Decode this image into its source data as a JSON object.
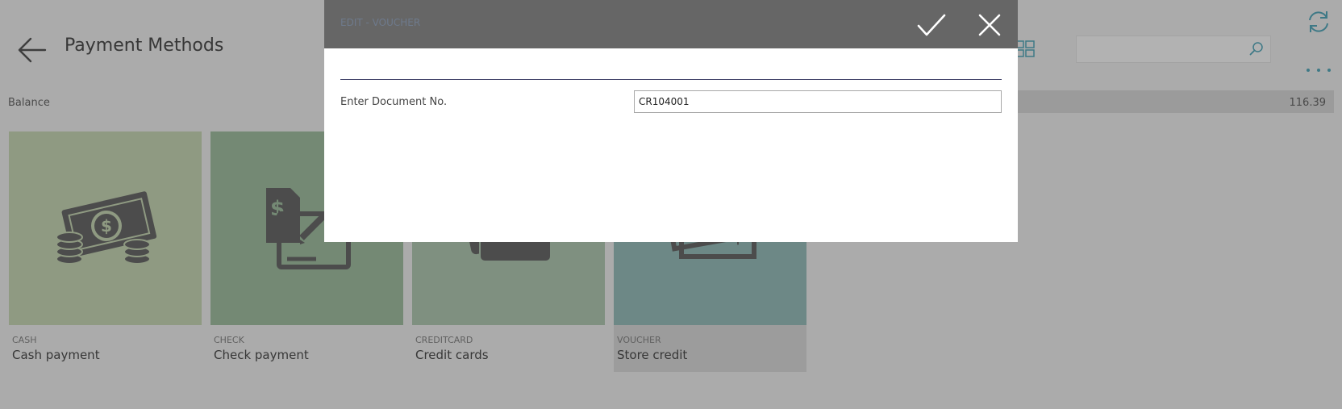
{
  "header": {
    "title": "Payment Methods",
    "back_icon": "arrow-left-icon",
    "search": {
      "value": "",
      "placeholder": ""
    },
    "icons": [
      "grid-view-icon",
      "search-icon",
      "refresh-icon",
      "more-icon"
    ]
  },
  "balance": {
    "label": "Balance",
    "value": "116.39"
  },
  "tiles": [
    {
      "code": "CASH",
      "name": "Cash payment",
      "icon": "cash-icon",
      "color": "#cdddba"
    },
    {
      "code": "CHECK",
      "name": "Check payment",
      "icon": "check-icon",
      "color": "#a6c4a6"
    },
    {
      "code": "CREDITCARD",
      "name": "Credit cards",
      "icon": "credit-card-icon",
      "color": "#b7ceb8"
    },
    {
      "code": "VOUCHER",
      "name": "Store credit",
      "icon": "voucher-icon",
      "color": "#9dc3c0"
    }
  ],
  "dialog": {
    "title": "EDIT - VOUCHER",
    "ok_icon": "checkmark-icon",
    "close_icon": "close-icon",
    "field_label": "Enter Document No.",
    "field_value": "CR104001"
  },
  "colors": {
    "accent": "#5aaec0",
    "dialog_header": "#666666",
    "overlay": "rgba(0,0,0,0.3)"
  }
}
